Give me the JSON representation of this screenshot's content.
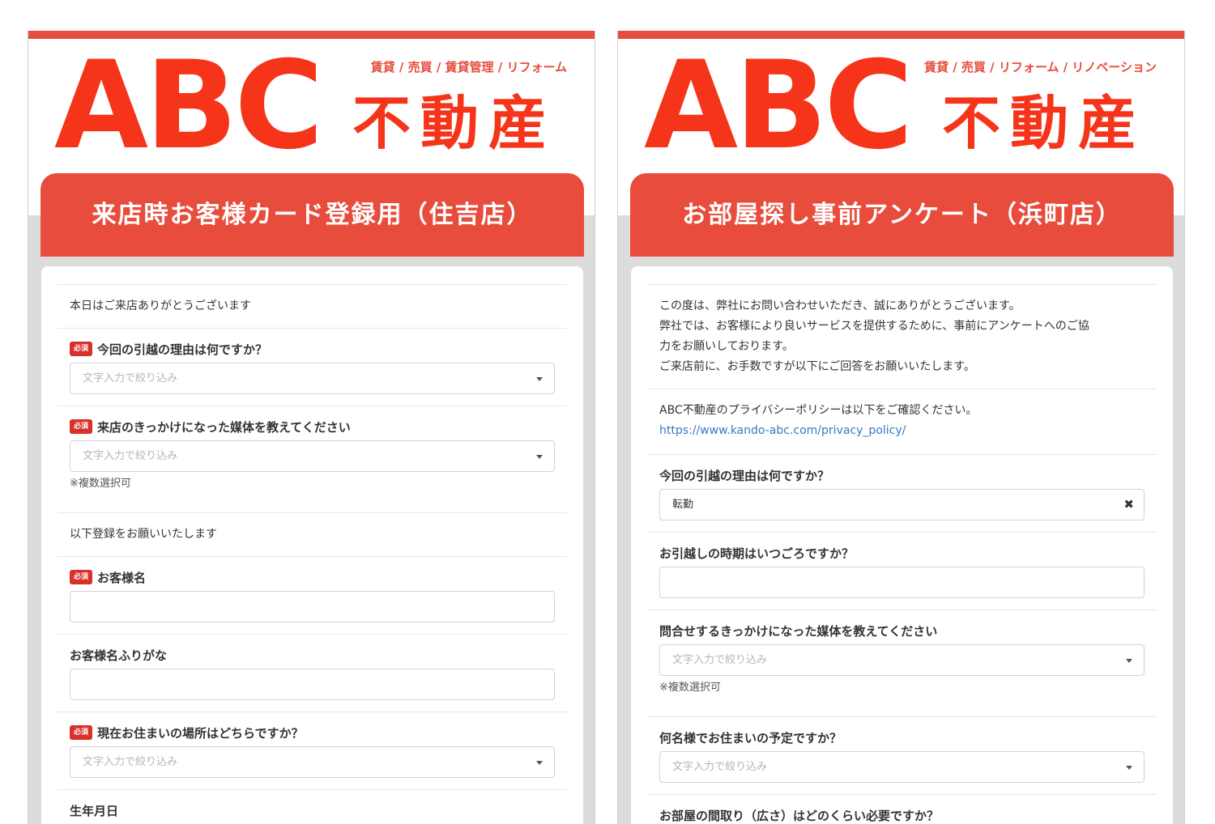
{
  "brand": {
    "abc": "ABC",
    "kanji": "不動産",
    "accent_color": "#e84c3d",
    "logo_color": "#f5341a"
  },
  "left": {
    "tagline": "賃貸 / 売買 / 賃貸管理 / リフォーム",
    "form_title": "来店時お客様カード登録用（住吉店）",
    "intro": "本日はご来店ありがとうございます",
    "required_badge": "必須",
    "q1": {
      "label": "今回の引越の理由は何ですか？",
      "placeholder": "文字入力で絞り込み"
    },
    "q2": {
      "label": "来店のきっかけになった媒体を教えてください",
      "placeholder": "文字入力で絞り込み",
      "note": "※複数選択可"
    },
    "register_prompt": "以下登録をお願いいたします",
    "q3": {
      "label": "お客様名",
      "value": ""
    },
    "q4": {
      "label": "お客様名ふりがな",
      "value": ""
    },
    "q5": {
      "label": "現在お住まいの場所はどちらですか？",
      "placeholder": "文字入力で絞り込み"
    },
    "q6": {
      "label": "生年月日"
    }
  },
  "right": {
    "tagline": "賃貸 / 売買 / リフォーム / リノベーション",
    "form_title": "お部屋探し事前アンケート（浜町店）",
    "intro_lines": [
      "この度は、弊社にお問い合わせいただき、誠にありがとうございます。",
      "弊社では、お客様により良いサービスを提供するために、事前にアンケートへのご協",
      "力をお願いしております。",
      "ご来店前に、お手数ですが以下にご回答をお願いいたします。"
    ],
    "privacy_text": "ABC不動産のプライバシーポリシーは以下をご確認ください。",
    "privacy_link": "https://www.kando-abc.com/privacy_policy/",
    "q1": {
      "label": "今回の引越の理由は何ですか？",
      "value": "転勤",
      "clear": "✖"
    },
    "q2": {
      "label": "お引越しの時期はいつごろですか？",
      "value": ""
    },
    "q3": {
      "label": "問合せするきっかけになった媒体を教えてください",
      "placeholder": "文字入力で絞り込み",
      "note": "※複数選択可"
    },
    "q4": {
      "label": "何名様でお住まいの予定ですか？",
      "placeholder": "文字入力で絞り込み"
    },
    "q5": {
      "label": "お部屋の間取り（広さ）はどのくらい必要ですか？"
    }
  }
}
